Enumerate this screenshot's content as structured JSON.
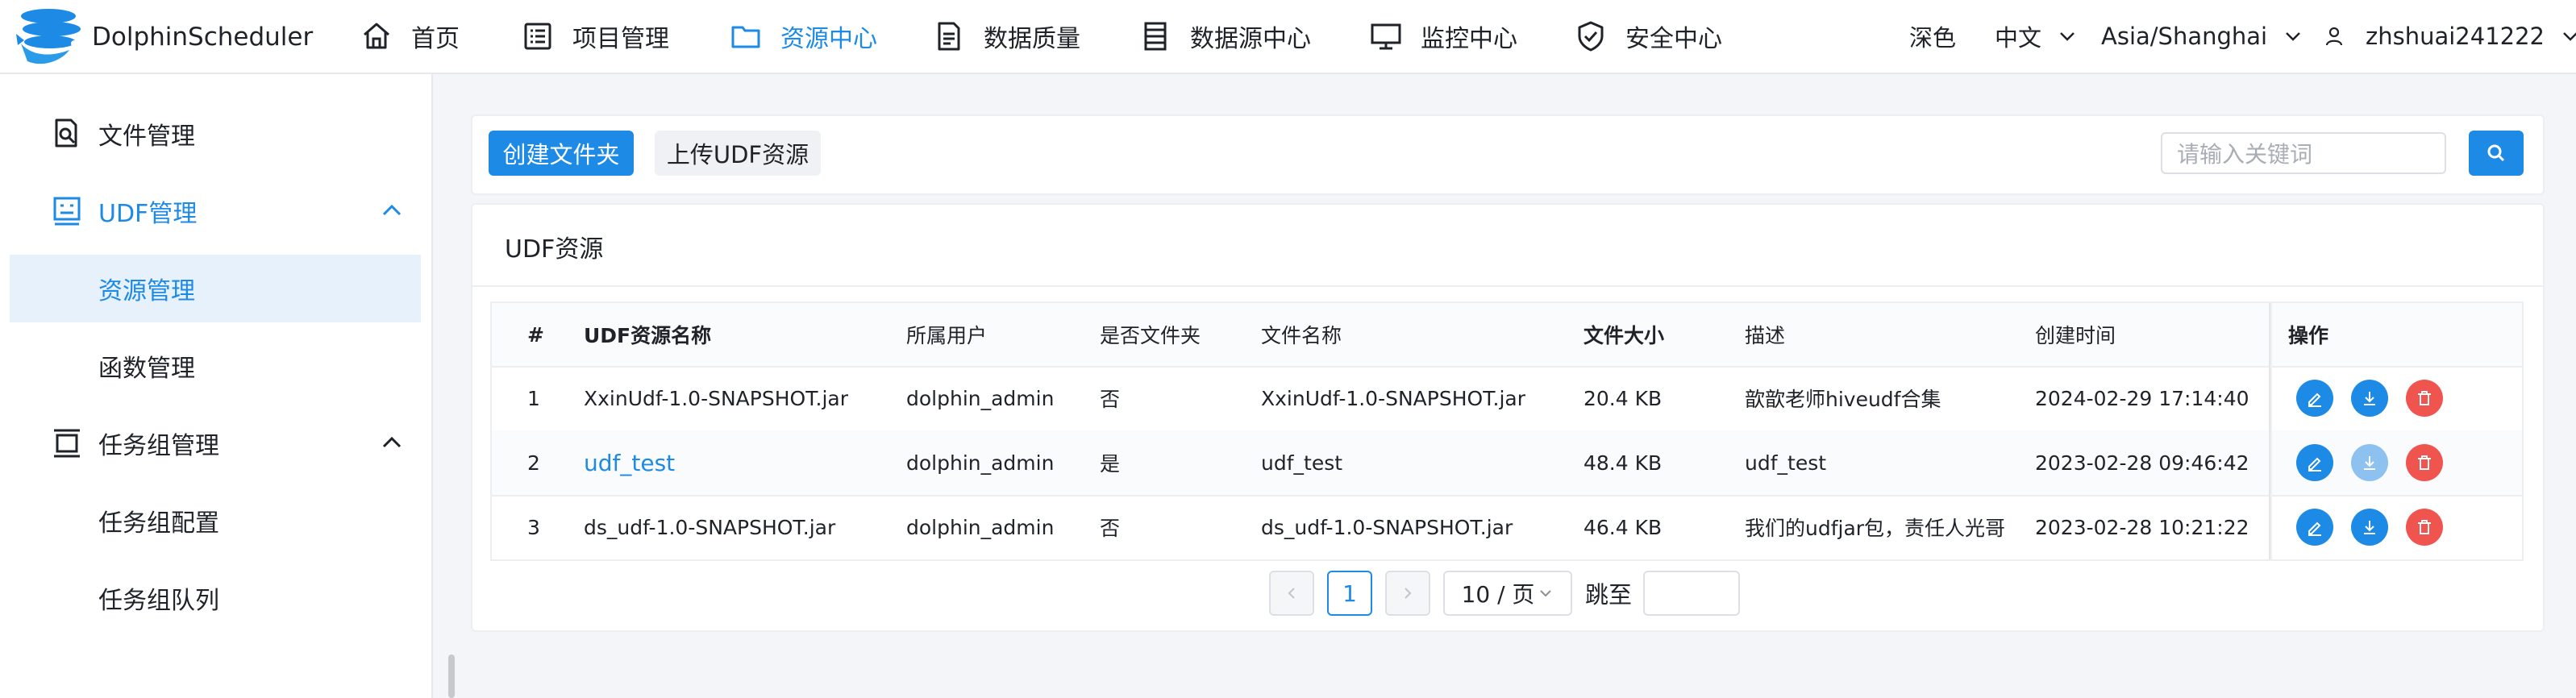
{
  "app": {
    "name": "DolphinScheduler"
  },
  "nav": {
    "items": [
      {
        "label": "首页",
        "icon": "home-icon"
      },
      {
        "label": "项目管理",
        "icon": "project-icon"
      },
      {
        "label": "资源中心",
        "icon": "folder-icon",
        "active": true
      },
      {
        "label": "数据质量",
        "icon": "data-quality-icon"
      },
      {
        "label": "数据源中心",
        "icon": "datasource-icon"
      },
      {
        "label": "监控中心",
        "icon": "monitor-icon"
      },
      {
        "label": "安全中心",
        "icon": "shield-icon"
      }
    ],
    "theme_label": "深色",
    "language": "中文",
    "timezone": "Asia/Shanghai",
    "username": "zhshuai241222"
  },
  "sidebar": {
    "items": [
      {
        "label": "文件管理",
        "icon": "file-search-icon"
      },
      {
        "label": "UDF管理",
        "icon": "udf-icon"
      },
      {
        "label": "资源管理"
      },
      {
        "label": "函数管理"
      },
      {
        "label": "任务组管理",
        "icon": "task-group-icon"
      },
      {
        "label": "任务组配置"
      },
      {
        "label": "任务组队列"
      }
    ]
  },
  "toolbar": {
    "create_folder_label": "创建文件夹",
    "upload_label": "上传UDF资源",
    "search_placeholder": "请输入关键词"
  },
  "table": {
    "title": "UDF资源",
    "headers": [
      "#",
      "UDF资源名称",
      "所属用户",
      "是否文件夹",
      "文件名称",
      "文件大小",
      "描述",
      "创建时间",
      "操作"
    ],
    "rows": [
      {
        "index": "1",
        "name": "XxinUdf-1.0-SNAPSHOT.jar",
        "user": "dolphin_admin",
        "is_dir": "否",
        "file_name": "XxinUdf-1.0-SNAPSHOT.jar",
        "size": "20.4 KB",
        "desc": "歆歆老师hiveudf合集",
        "created": "2024-02-29 17:14:40"
      },
      {
        "index": "2",
        "name": "udf_test",
        "user": "dolphin_admin",
        "is_dir": "是",
        "file_name": "udf_test",
        "size": "48.4 KB",
        "desc": "udf_test",
        "created": "2023-02-28 09:46:42"
      },
      {
        "index": "3",
        "name": "ds_udf-1.0-SNAPSHOT.jar",
        "user": "dolphin_admin",
        "is_dir": "否",
        "file_name": "ds_udf-1.0-SNAPSHOT.jar",
        "size": "46.4 KB",
        "desc": "我们的udfjar包，责任人光哥",
        "created": "2023-02-28 10:21:22"
      }
    ]
  },
  "pagination": {
    "current_page": "1",
    "page_size": "10 / 页",
    "jump_label": "跳至"
  },
  "colors": {
    "primary": "#1d8ae6",
    "danger": "#f0544f",
    "selected_bg": "#e6f1fc"
  }
}
